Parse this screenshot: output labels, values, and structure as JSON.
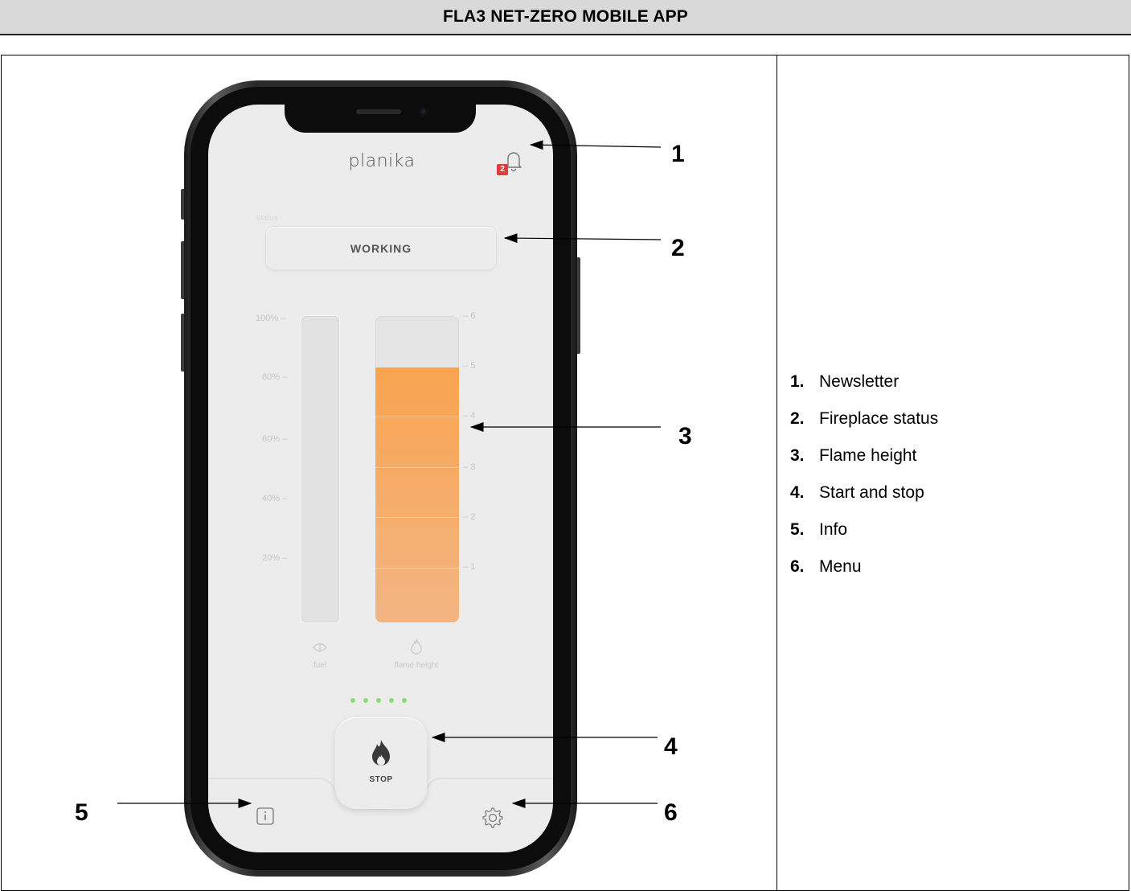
{
  "header": {
    "title": "FLA3 NET-ZERO MOBILE APP"
  },
  "app": {
    "brand": "planika",
    "notification_count": "2",
    "status_caption": "status",
    "status_value": "WORKING",
    "fuel_ticks": [
      "100%",
      "80%",
      "60%",
      "40%",
      "20%"
    ],
    "flame_ticks": [
      "6",
      "5",
      "4",
      "3",
      "2",
      "1"
    ],
    "fuel_label": "fuel",
    "flame_label": "flame height",
    "flame_level": 5,
    "flame_max": 6,
    "stop_label": "STOP",
    "indicator_dots": 5,
    "accent_color": "#f8a450",
    "icons": {
      "bell": "bell-icon",
      "fuel": "fuel-icon",
      "flame": "flame-icon",
      "info": "info-icon",
      "settings": "gear-icon"
    }
  },
  "callouts": [
    "1",
    "2",
    "3",
    "4",
    "5",
    "6"
  ],
  "legend": [
    {
      "num": "1.",
      "label": "Newsletter"
    },
    {
      "num": "2.",
      "label": "Fireplace status"
    },
    {
      "num": "3.",
      "label": "Flame height"
    },
    {
      "num": "4.",
      "label": "Start and stop"
    },
    {
      "num": "5.",
      "label": "Info"
    },
    {
      "num": "6.",
      "label": "Menu"
    }
  ]
}
